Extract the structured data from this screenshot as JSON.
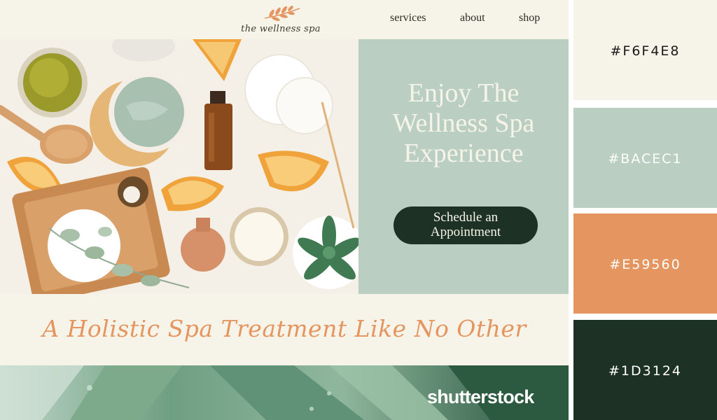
{
  "header": {
    "logo_text": "the wellness spa",
    "nav": [
      "services",
      "about",
      "shop"
    ]
  },
  "hero": {
    "title_lines": [
      "Enjoy The",
      "Wellness Spa",
      "Experience"
    ],
    "cta_lines": [
      "Schedule an",
      "Appointment"
    ]
  },
  "tagline": "A Holistic Spa Treatment Like No Other",
  "watermark": "shutterstock",
  "palette": [
    {
      "hex": "#F6F4E8",
      "label": "#F6F4E8"
    },
    {
      "hex": "#BACEC1",
      "label": "#BACEC1"
    },
    {
      "hex": "#E59560",
      "label": "#E59560"
    },
    {
      "hex": "#1D3124",
      "label": "#1D3124"
    }
  ]
}
